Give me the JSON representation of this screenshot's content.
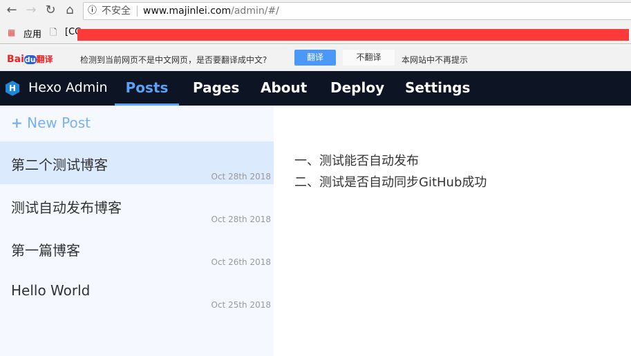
{
  "browser": {
    "url_prefix": "不安全",
    "url_host": "www.majinlei.com",
    "url_path": "/admin/#/",
    "bookmark_apps": "应用",
    "bookmark_1": "[CC"
  },
  "translate": {
    "brand": "Bai",
    "brand2": "du",
    "brand3": "翻译",
    "prompt": "检测到当前网页不是中文网页，是否要翻译成中文?",
    "translate_btn": "翻译",
    "no_translate_btn": "不翻译",
    "never_btn": "本网站中不再提示"
  },
  "nav": {
    "logo": "H",
    "title": "Hexo Admin",
    "items": [
      "Posts",
      "Pages",
      "About",
      "Deploy",
      "Settings"
    ],
    "active": "Posts",
    "accent": "#5aa2f7"
  },
  "sidebar": {
    "new_post": "New Post",
    "posts": [
      {
        "title": "第二个测试博客",
        "date": "Oct 28th 2018",
        "selected": true
      },
      {
        "title": "测试自动发布博客",
        "date": "Oct 28th 2018"
      },
      {
        "title": "第一篇博客",
        "date": "Oct 26th 2018"
      },
      {
        "title": "Hello World",
        "date": "Oct 25th 2018"
      }
    ]
  },
  "content": {
    "lines": [
      "一、测试能否自动发布",
      "二、测试是否自动同步GitHub成功"
    ]
  }
}
